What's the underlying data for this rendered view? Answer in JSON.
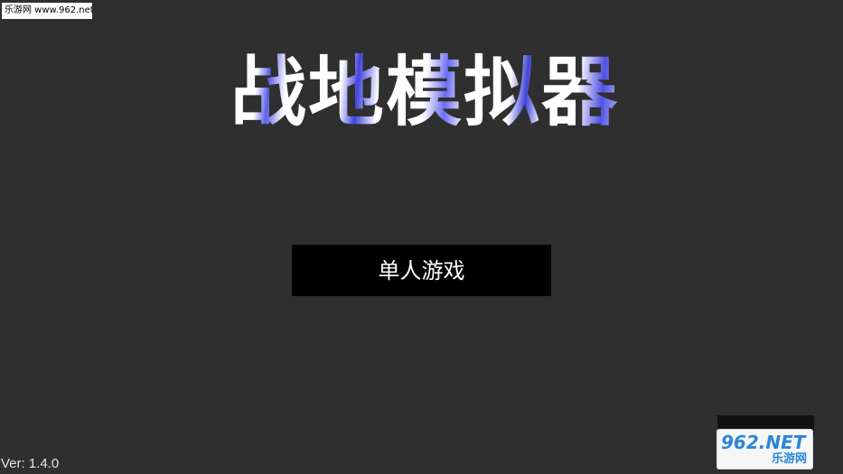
{
  "watermark_top": "乐游网 www.962.net",
  "title": "战地模拟器",
  "buttons": {
    "single_player": "单人游戏"
  },
  "version": "Ver: 1.4.0",
  "watermark_br": {
    "brand": "962.NET",
    "name": "乐游网"
  },
  "colors": {
    "background": "#2f2f2f",
    "button": "#000000",
    "title_accent": "#4144de"
  }
}
